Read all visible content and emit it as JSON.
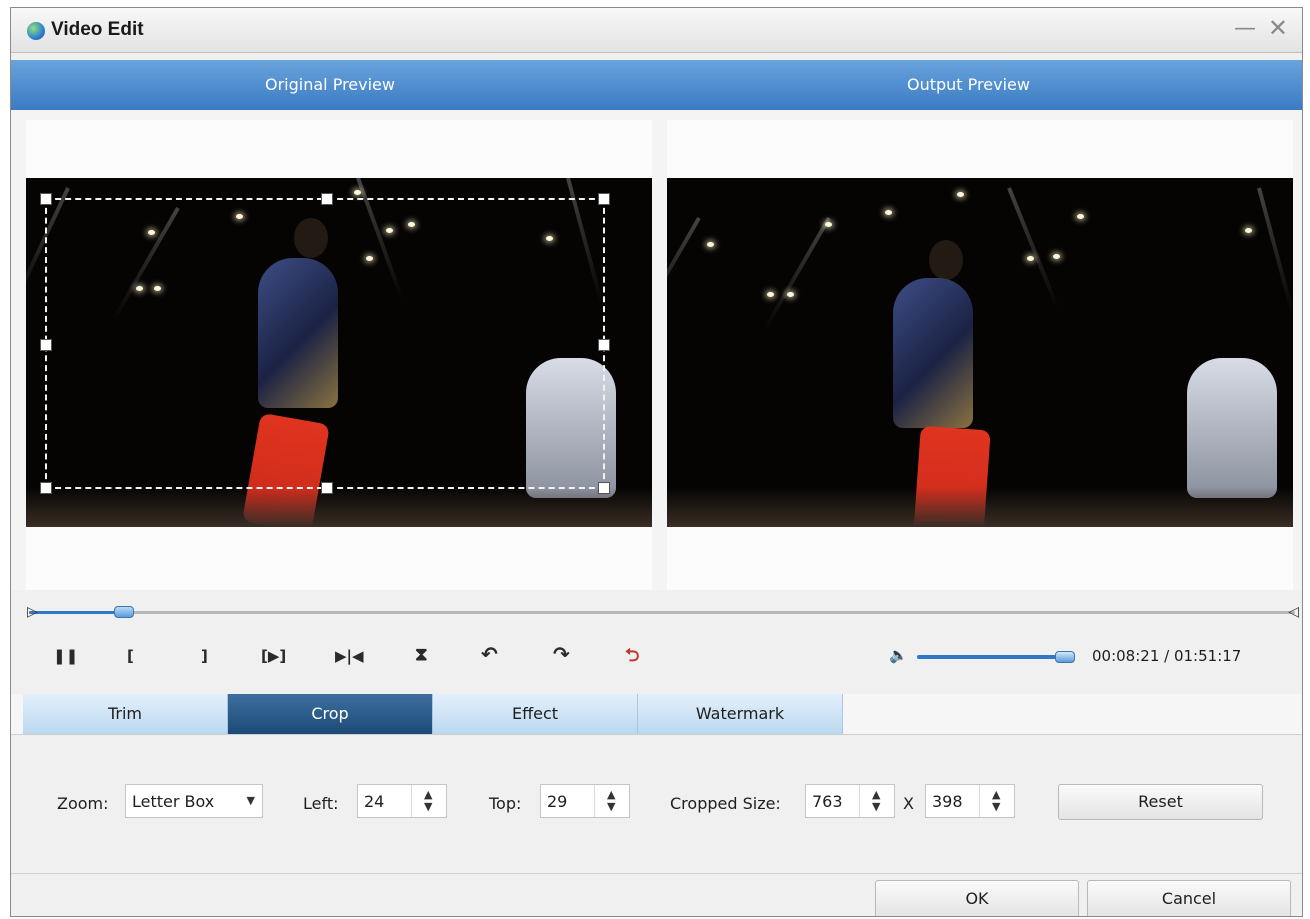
{
  "window": {
    "title": "Video Edit",
    "icon": "app-logo-icon"
  },
  "preview": {
    "original_label": "Original Preview",
    "output_label": "Output Preview"
  },
  "timeline": {
    "position_fraction": 0.075
  },
  "controls": {
    "pause_glyph": "❚❚",
    "mark_in_glyph": "[",
    "mark_out_glyph": "]",
    "play_segment_glyph": "[▶]",
    "split_glyph": "▶|◀",
    "flip_vertical_glyph": "⧗",
    "rotate_left_glyph": "↶",
    "rotate_right_glyph": "↷",
    "undo_glyph": "⮌",
    "volume_glyph": "🔈",
    "volume_fraction": 0.95,
    "current_time": "00:08:21",
    "separator": " / ",
    "total_time": "01:51:17"
  },
  "tabs": [
    {
      "label": "Trim",
      "active": false
    },
    {
      "label": "Crop",
      "active": true
    },
    {
      "label": "Effect",
      "active": false
    },
    {
      "label": "Watermark",
      "active": false
    }
  ],
  "crop_panel": {
    "zoom_label": "Zoom:",
    "zoom_value": "Letter Box",
    "left_label": "Left:",
    "left_value": "24",
    "top_label": "Top:",
    "top_value": "29",
    "size_label": "Cropped Size:",
    "width_value": "763",
    "x_label": "X",
    "height_value": "398",
    "reset_label": "Reset"
  },
  "footer": {
    "ok_label": "OK",
    "cancel_label": "Cancel"
  },
  "colors": {
    "accent": "#3a7bc4",
    "active_tab": "#1c4a78",
    "tab": "#bcd8f0"
  }
}
